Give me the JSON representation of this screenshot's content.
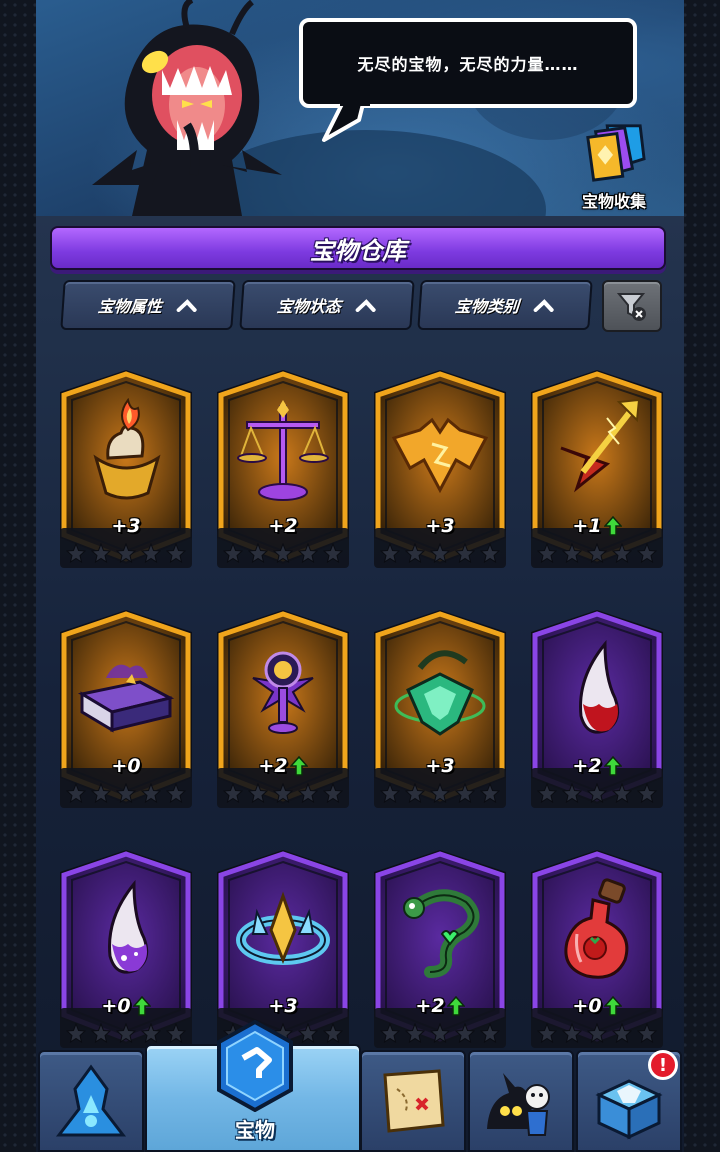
{
  "banner": {
    "speech_text": "无尽的宝物，无尽的力量……",
    "collection_label": "宝物收集"
  },
  "title": "宝物仓库",
  "filters": [
    {
      "label": "宝物属性"
    },
    {
      "label": "宝物状态"
    },
    {
      "label": "宝物类别"
    }
  ],
  "colors": {
    "gold_frame": "#f0a51c",
    "purple_frame": "#8a45e6",
    "title_purple": "#7d3ae0",
    "upgrade_green": "#3fd93b",
    "badge_red": "#e31b2b"
  },
  "items": [
    {
      "name": "candle-pot",
      "icon": "candle-icon",
      "rarity": "gold",
      "level": "+3",
      "upgradable": false
    },
    {
      "name": "scales",
      "icon": "scales-icon",
      "rarity": "gold",
      "level": "+2",
      "upgradable": false
    },
    {
      "name": "bat-wing",
      "icon": "bat-wing-icon",
      "rarity": "gold",
      "level": "+3",
      "upgradable": false
    },
    {
      "name": "lightning-spear",
      "icon": "lightning-spear-icon",
      "rarity": "gold",
      "level": "+1",
      "upgradable": true
    },
    {
      "name": "cursed-book",
      "icon": "book-icon",
      "rarity": "gold",
      "level": "+0",
      "upgradable": false
    },
    {
      "name": "eye-chalice",
      "icon": "chalice-icon",
      "rarity": "gold",
      "level": "+2",
      "upgradable": true
    },
    {
      "name": "emerald-amulet",
      "icon": "amulet-icon",
      "rarity": "gold",
      "level": "+3",
      "upgradable": false
    },
    {
      "name": "red-fang",
      "icon": "fang-icon",
      "rarity": "purple",
      "level": "+2",
      "upgradable": true
    },
    {
      "name": "purple-fang",
      "icon": "fang-icon",
      "rarity": "purple",
      "level": "+0",
      "upgradable": true
    },
    {
      "name": "crystal-ring",
      "icon": "ring-icon",
      "rarity": "purple",
      "level": "+3",
      "upgradable": false
    },
    {
      "name": "serpent",
      "icon": "serpent-icon",
      "rarity": "purple",
      "level": "+2",
      "upgradable": true
    },
    {
      "name": "tomato-potion",
      "icon": "potion-icon",
      "rarity": "purple",
      "level": "+0",
      "upgradable": true
    }
  ],
  "nav": {
    "active_label": "宝物",
    "badge": "!",
    "tabs": [
      {
        "icon": "blue-tower-icon"
      },
      {
        "icon": "treasure-hex-icon",
        "active": true
      },
      {
        "icon": "treasure-map-icon"
      },
      {
        "icon": "heroes-icon"
      },
      {
        "icon": "gift-box-icon"
      }
    ]
  }
}
